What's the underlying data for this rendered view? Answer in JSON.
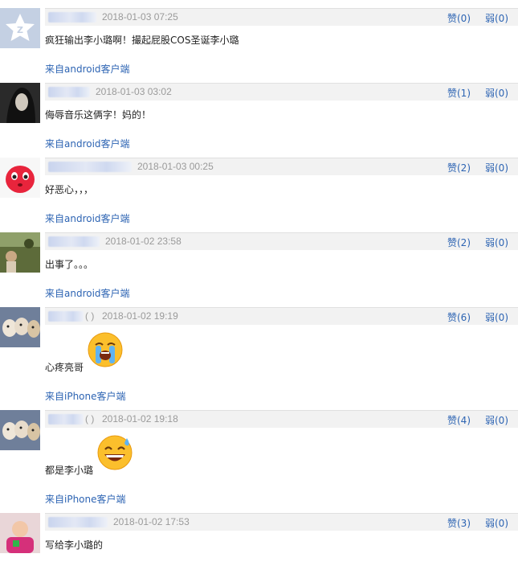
{
  "comments": [
    {
      "time": "2018-01-03 07:25",
      "text": "疯狂输出李小璐啊！撮起屁股COS圣诞李小璐",
      "source": "来自android客户端",
      "up": "赞(0)",
      "down": "弱(0)",
      "avatar_icon": "default-avatar-icon"
    },
    {
      "time": "2018-01-03 03:02",
      "text": "侮辱音乐这俩字！妈的！",
      "source": "来自android客户端",
      "up": "赞(1)",
      "down": "弱(0)",
      "avatar_icon": "photo-avatar"
    },
    {
      "time": "2018-01-03 00:25",
      "text": "好恶心，，，",
      "source": "来自android客户端",
      "up": "赞(2)",
      "down": "弱(0)",
      "avatar_icon": "cartoon-avatar"
    },
    {
      "time": "2018-01-02 23:58",
      "text": "出事了。。。",
      "source": "来自android客户端",
      "up": "赞(2)",
      "down": "弱(0)",
      "avatar_icon": "photo-avatar"
    },
    {
      "time": "2018-01-02 19:19",
      "text": "心疼亮哥",
      "source": "来自iPhone客户端",
      "up": "赞(6)",
      "down": "弱(0)",
      "avatar_icon": "dogs-photo-avatar",
      "name_suffix": "( )",
      "emoji": "crying-emoji-icon"
    },
    {
      "time": "2018-01-02 19:18",
      "text": "都是李小璐",
      "source": "来自iPhone客户端",
      "up": "赞(4)",
      "down": "弱(0)",
      "avatar_icon": "dogs-photo-avatar",
      "name_suffix": "( )",
      "emoji": "sweat-smile-emoji-icon"
    },
    {
      "time": "2018-01-02 17:53",
      "text": "写给李小璐的",
      "source": "",
      "up": "赞(3)",
      "down": "弱(0)",
      "avatar_icon": "photo-avatar"
    }
  ]
}
